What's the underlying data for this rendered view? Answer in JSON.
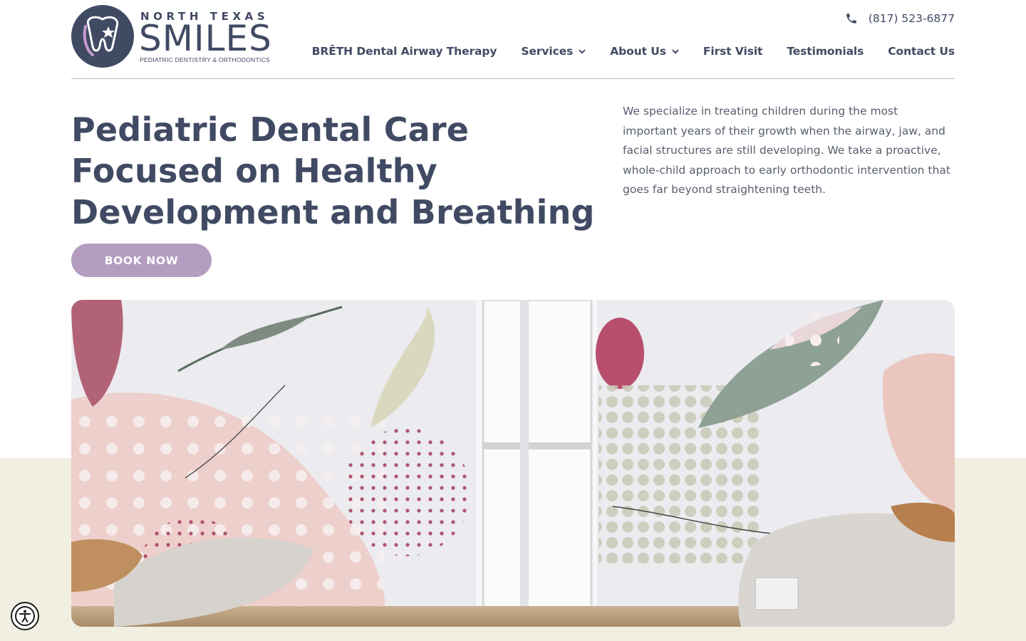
{
  "brand": {
    "name_top": "NORTH TEXAS",
    "name_main": "SMILES",
    "tagline": "PEDIATRIC DENTISTRY & ORTHODONTICS"
  },
  "header": {
    "phone": "(817) 523-6877",
    "nav": [
      {
        "label": "BRĒTH Dental Airway Therapy",
        "has_dropdown": false
      },
      {
        "label": "Services",
        "has_dropdown": true
      },
      {
        "label": "About Us",
        "has_dropdown": true
      },
      {
        "label": "First Visit",
        "has_dropdown": false
      },
      {
        "label": "Testimonials",
        "has_dropdown": false
      },
      {
        "label": "Contact Us",
        "has_dropdown": false
      }
    ]
  },
  "hero": {
    "title": "Pediatric Dental Care Focused on Healthy Development and Breathing",
    "description": "We specialize in treating children during the most important years of their growth when the airway, jaw, and facial structures are still developing. We take a proactive, whole-child approach to early orthodontic intervention that goes far beyond straightening teeth.",
    "cta_label": "BOOK NOW"
  },
  "colors": {
    "navy": "#414a63",
    "lavender": "#b49dc1",
    "beige": "#f1efe1"
  },
  "icons": {
    "phone": "phone-icon",
    "dropdown": "chevron-down-icon",
    "accessibility": "accessibility-icon"
  }
}
